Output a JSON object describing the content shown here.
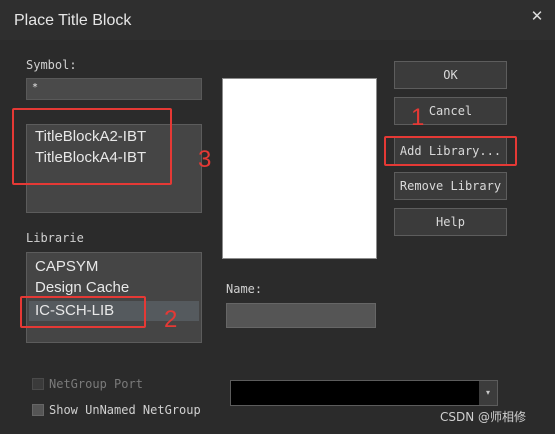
{
  "window": {
    "title": "Place Title Block",
    "close_glyph": "✕"
  },
  "symbol": {
    "label": "Symbol:",
    "filter_value": "*",
    "items": [
      "TitleBlockA2-IBT",
      "TitleBlockA4-IBT"
    ]
  },
  "libraries": {
    "label": "Librarie",
    "items": [
      "CAPSYM",
      "Design Cache",
      "IC-SCH-LIB"
    ],
    "selected_index": 2
  },
  "name": {
    "label": "Name:",
    "value": ""
  },
  "buttons": {
    "ok": "OK",
    "cancel": "Cancel",
    "add_library": "Add Library...",
    "remove_library": "Remove Library",
    "help": "Help"
  },
  "options": {
    "netgroup_port": {
      "label": "NetGroup Port",
      "checked": false,
      "enabled": false
    },
    "show_unnamed": {
      "label": "Show UnNamed NetGroup",
      "checked": false,
      "enabled": true
    }
  },
  "combo": {
    "value": "",
    "arrow_glyph": "▾"
  },
  "annotations": {
    "one": "1",
    "two": "2",
    "three": "3",
    "color": "#e53935"
  },
  "watermark": "CSDN @师相修"
}
